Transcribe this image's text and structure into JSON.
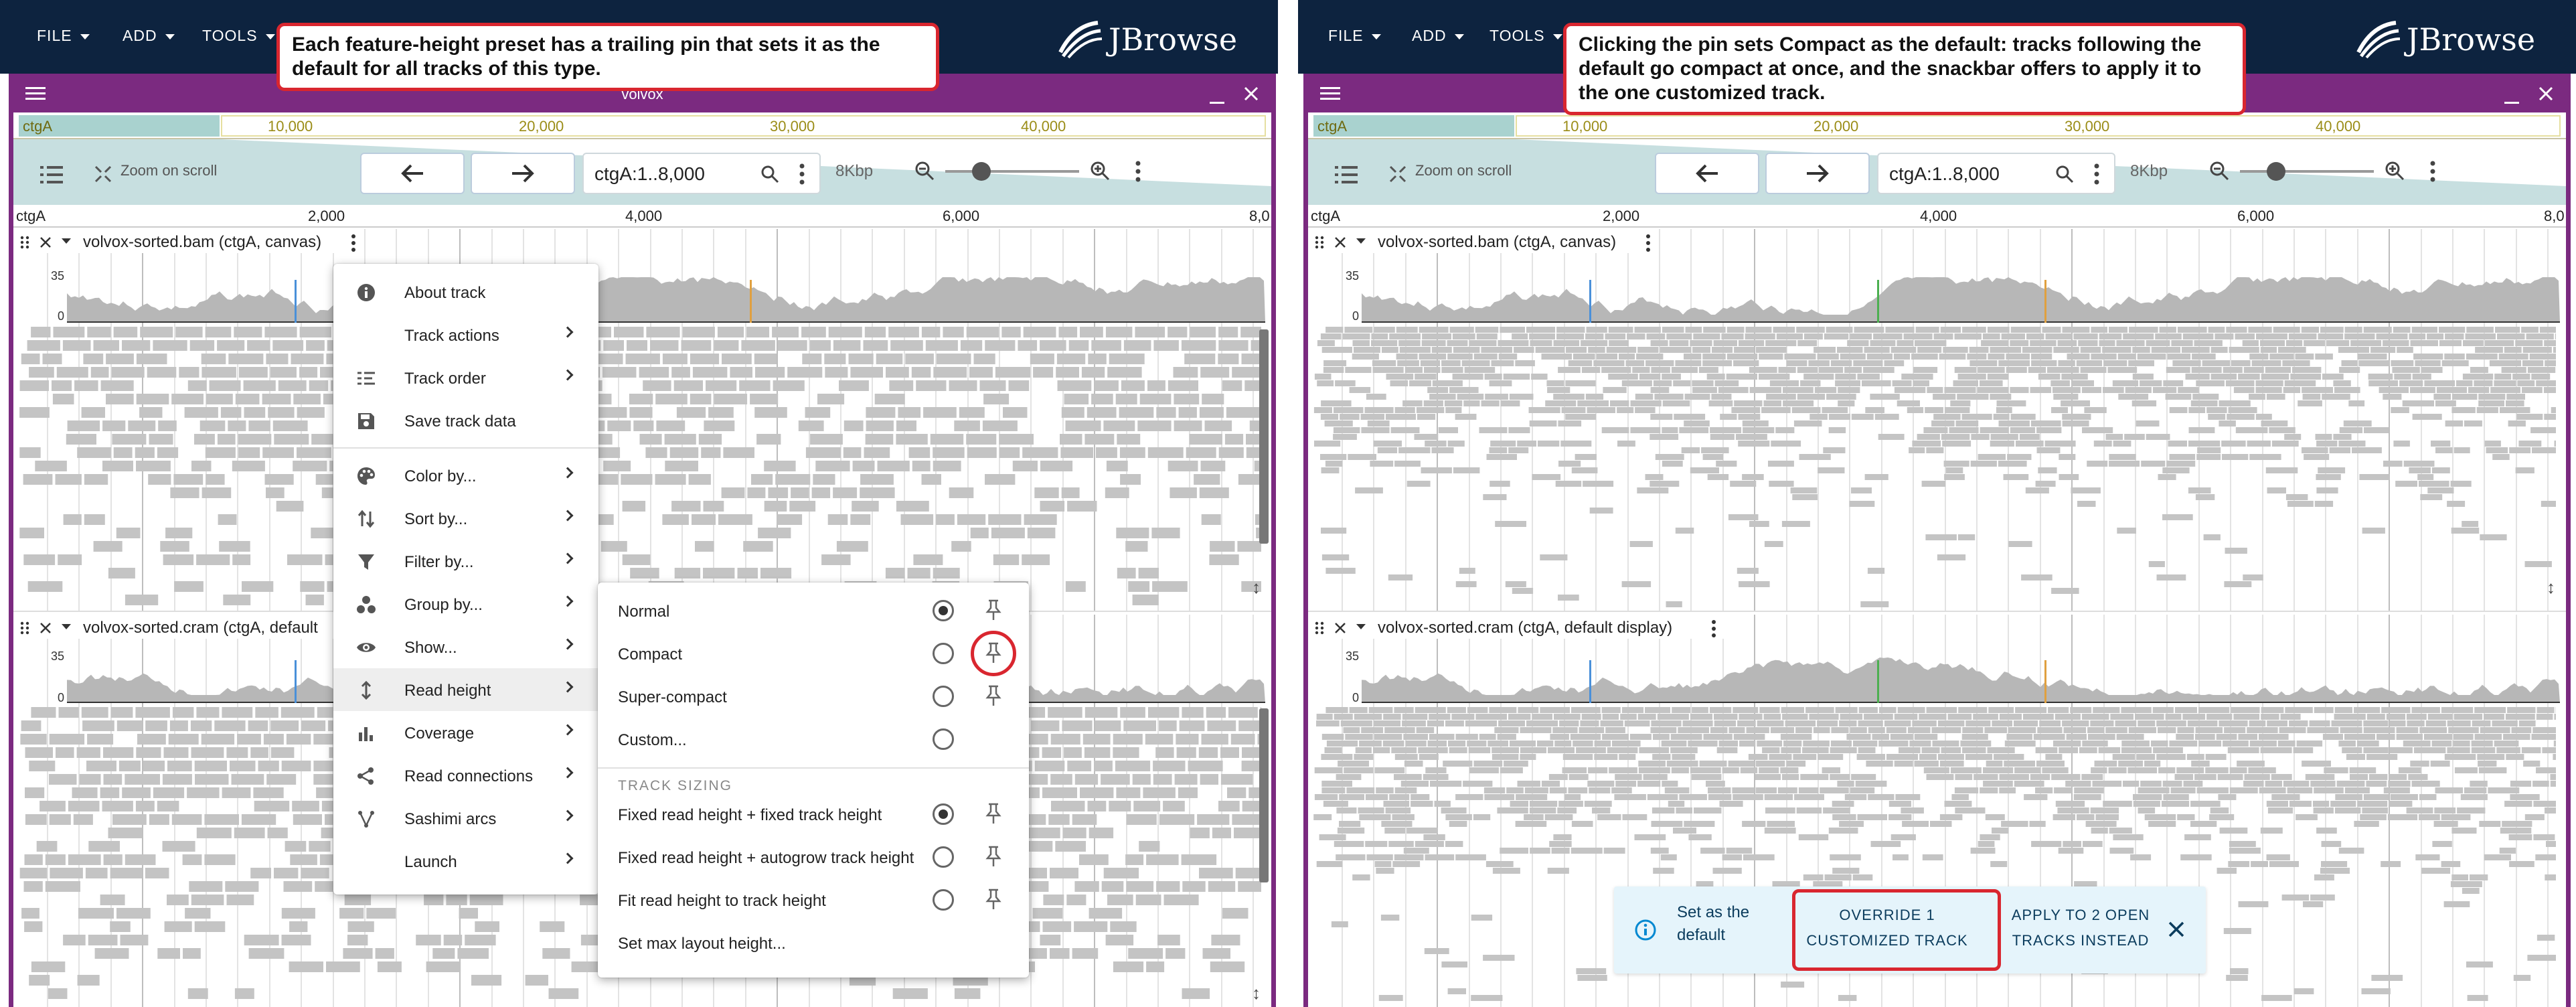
{
  "app": {
    "menus": [
      "FILE",
      "ADD",
      "TOOLS"
    ],
    "logo_text": "JBrowse",
    "view_name": "volvox"
  },
  "callouts": {
    "left": "Each feature-height preset has a trailing pin that sets it as the default for all tracks of this type.",
    "right": "Clicking the pin sets Compact as the default: tracks following the default go compact at once, and the snackbar offers to apply it to the one customized track."
  },
  "overview": {
    "refname": "ctgA",
    "labels": [
      "10,000",
      "20,000",
      "30,000",
      "40,000"
    ]
  },
  "nav": {
    "zoom_on_scroll": "Zoom on scroll",
    "location": "ctgA:1..8,000",
    "bp_per_px": "8Kbp",
    "back_icon": "arrow-left-icon",
    "forward_icon": "arrow-right-icon"
  },
  "ruler": {
    "refname": "ctgA",
    "labels": [
      "2,000",
      "4,000",
      "6,000",
      "8,0"
    ]
  },
  "tracks": {
    "bam_name": "volvox-sorted.bam (ctgA, canvas)",
    "cram_name_truncated": "volvox-sorted.cram (ctgA, default",
    "cram_name": "volvox-sorted.cram (ctgA, default display)",
    "cov_max": "35",
    "cov_min": "0"
  },
  "track_menu": {
    "items": [
      {
        "label": "About track",
        "icon": "info-icon",
        "submenu": false
      },
      {
        "label": "Track actions",
        "icon": "",
        "submenu": true
      },
      {
        "label": "Track order",
        "icon": "track-order-icon",
        "submenu": true
      },
      {
        "label": "Save track data",
        "icon": "save-icon",
        "submenu": false
      },
      {
        "label": "Color by...",
        "icon": "palette-icon",
        "submenu": true
      },
      {
        "label": "Sort by...",
        "icon": "sort-icon",
        "submenu": true
      },
      {
        "label": "Filter by...",
        "icon": "filter-icon",
        "submenu": true
      },
      {
        "label": "Group by...",
        "icon": "group-icon",
        "submenu": true
      },
      {
        "label": "Show...",
        "icon": "eye-icon",
        "submenu": true
      },
      {
        "label": "Read height",
        "icon": "height-icon",
        "submenu": true
      },
      {
        "label": "Coverage",
        "icon": "bar-chart-icon",
        "submenu": true
      },
      {
        "label": "Read connections",
        "icon": "connections-icon",
        "submenu": true
      },
      {
        "label": "Sashimi arcs",
        "icon": "sashimi-icon",
        "submenu": true
      },
      {
        "label": "Launch",
        "icon": "",
        "submenu": true
      }
    ]
  },
  "read_height_menu": {
    "presets": [
      {
        "label": "Normal",
        "selected": true,
        "pin": true
      },
      {
        "label": "Compact",
        "selected": false,
        "pin": true
      },
      {
        "label": "Super-compact",
        "selected": false,
        "pin": true
      },
      {
        "label": "Custom...",
        "selected": false,
        "pin": false
      }
    ],
    "sizing_header": "TRACK SIZING",
    "sizing": [
      {
        "label": "Fixed read height + fixed track height",
        "selected": true,
        "pin": true
      },
      {
        "label": "Fixed read height + autogrow track height",
        "selected": false,
        "pin": true
      },
      {
        "label": "Fit read height to track height",
        "selected": false,
        "pin": true
      },
      {
        "label": "Set max layout height...",
        "selected": false,
        "pin": false
      }
    ]
  },
  "snackbar": {
    "message": "Set as the default",
    "override_button": "OVERRIDE 1 CUSTOMIZED TRACK",
    "apply_button": "APPLY TO 2 OPEN TRACKS INSTEAD",
    "close_icon": "close-icon",
    "info_icon": "info-icon"
  },
  "colors": {
    "appbar": "#0d233f",
    "view_frame": "#7b2a80",
    "highlight": "#d9262f",
    "read_fill": "#c4c4c4",
    "coverage_fill": "#b7b7b7",
    "snackbar_bg": "#e5f4fb"
  }
}
